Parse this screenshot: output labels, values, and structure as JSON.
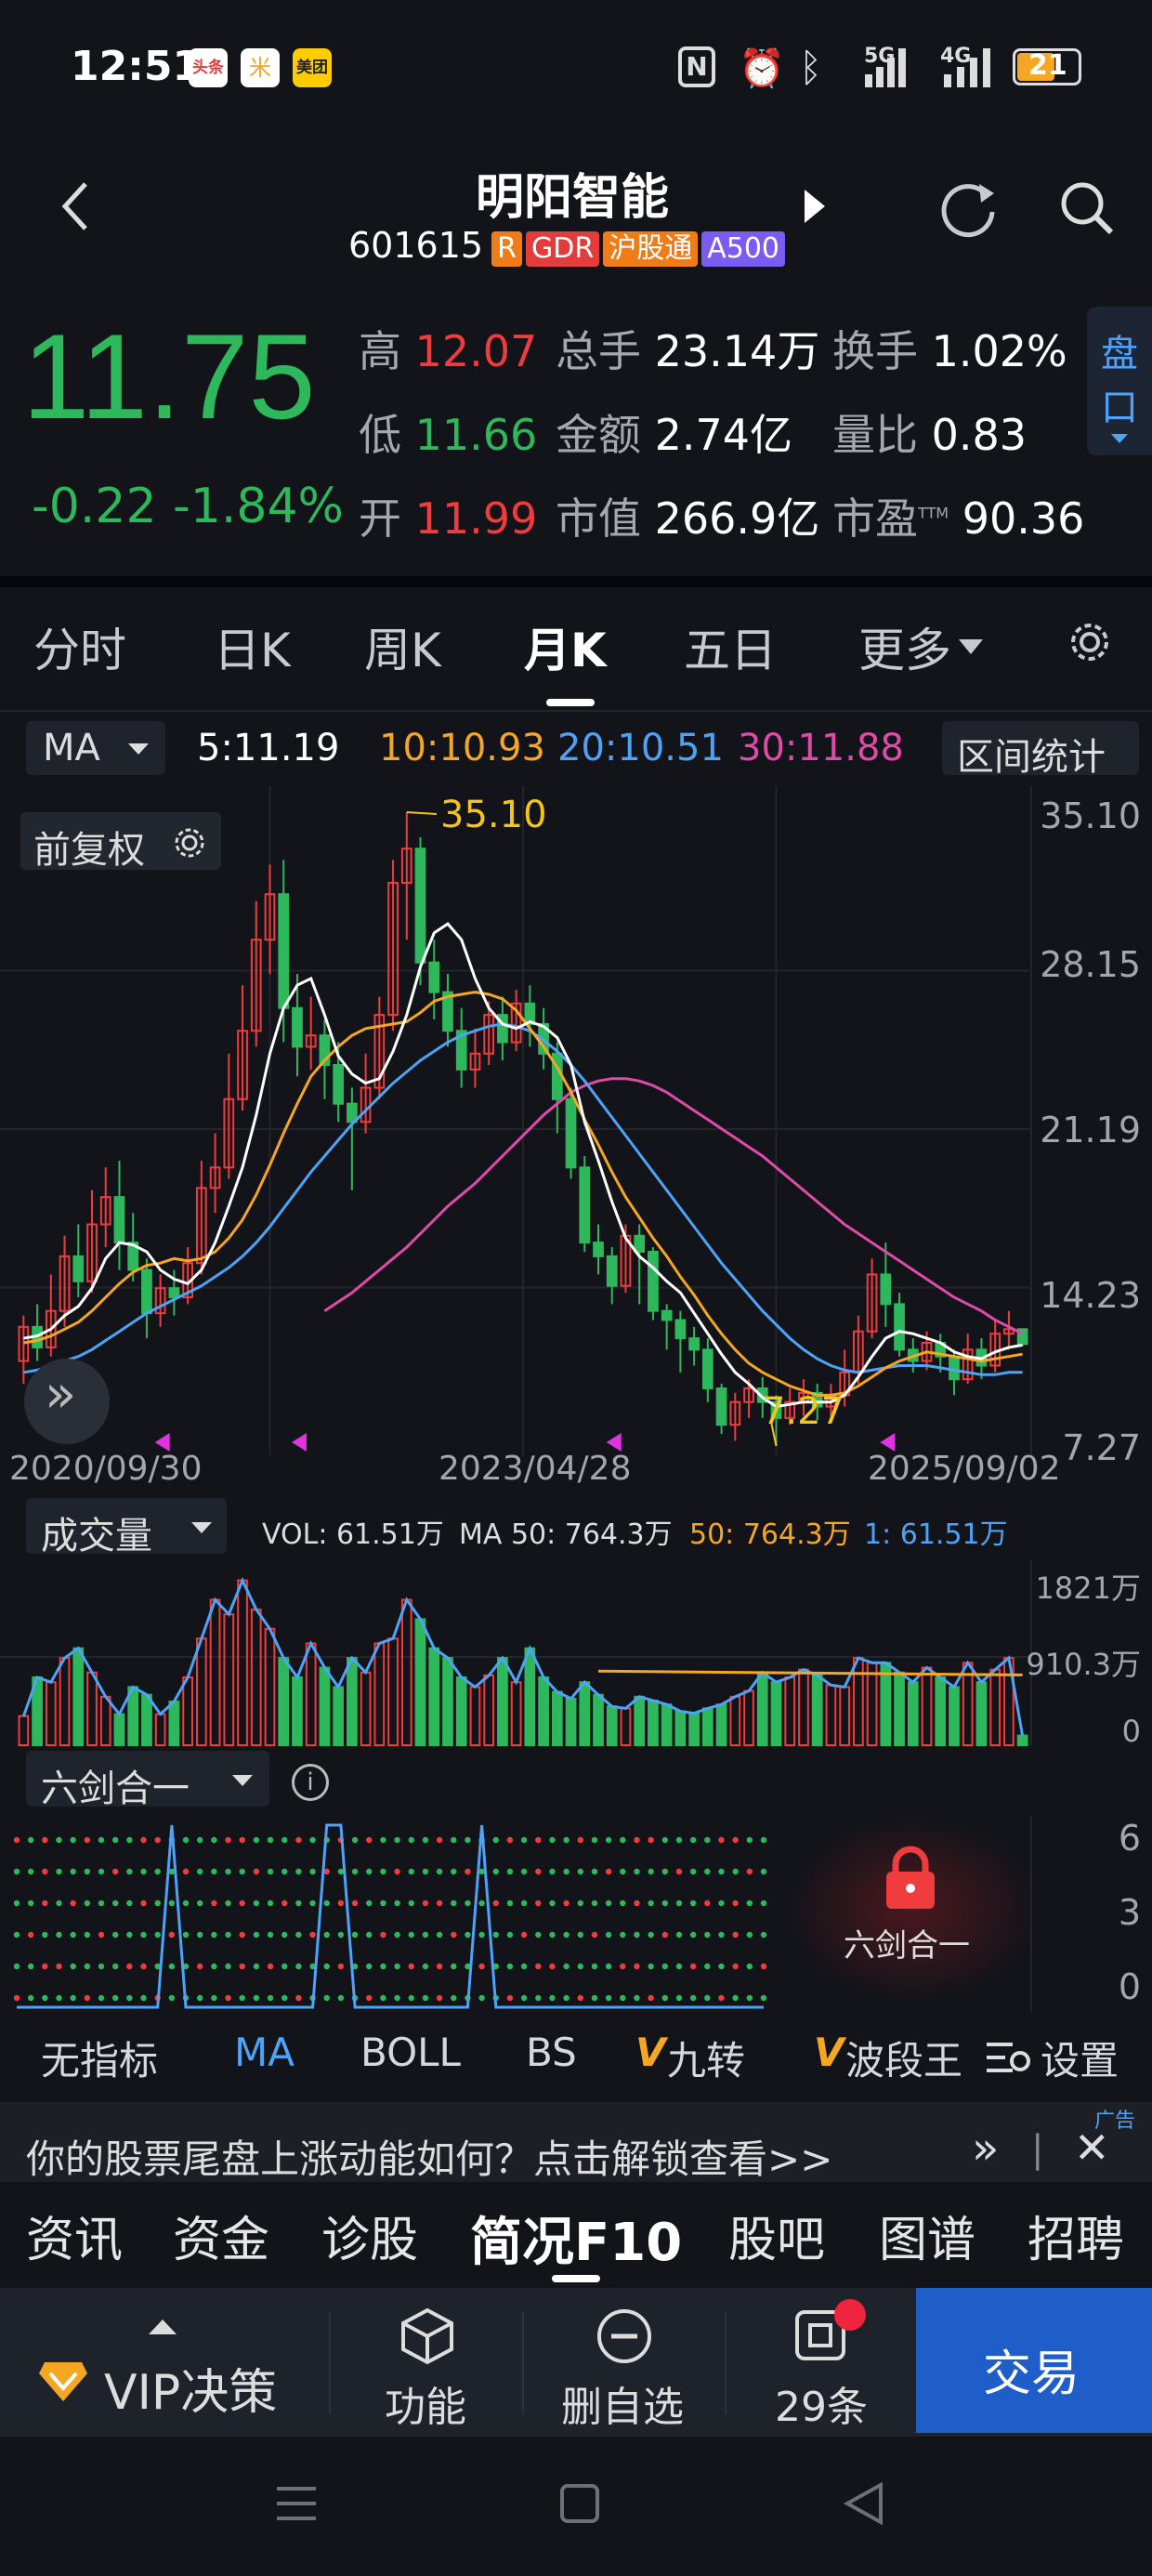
{
  "status_bar": {
    "time": "12:51",
    "app_badges": [
      "头条",
      "米",
      "美团"
    ],
    "network": "5G",
    "network2": "4G",
    "battery": "21"
  },
  "header": {
    "title": "明阳智能",
    "code": "601615",
    "tags": [
      {
        "label": "R",
        "color": "#f07c18"
      },
      {
        "label": "GDR",
        "color": "#e23c3c"
      },
      {
        "label": "沪股通",
        "color": "#f07c18"
      },
      {
        "label": "A500",
        "color": "#7a5cf0"
      }
    ]
  },
  "quote": {
    "price": "11.75",
    "change": "-0.22",
    "change_pct": "-1.84%",
    "rows": [
      [
        {
          "label": "高",
          "value": "12.07",
          "color": "up"
        },
        {
          "label": "总手",
          "value": "23.14万",
          "color": "white"
        },
        {
          "label": "换手",
          "value": "1.02%",
          "color": "white"
        }
      ],
      [
        {
          "label": "低",
          "value": "11.66",
          "color": "down"
        },
        {
          "label": "金额",
          "value": "2.74亿",
          "color": "white"
        },
        {
          "label": "量比",
          "value": "0.83",
          "color": "white"
        }
      ],
      [
        {
          "label": "开",
          "value": "11.99",
          "color": "up"
        },
        {
          "label": "市值",
          "value": "266.9亿",
          "color": "white"
        },
        {
          "label": "市盈",
          "value": "90.36",
          "color": "white"
        }
      ]
    ],
    "ttm": "TTM",
    "pankou": [
      "盘",
      "口"
    ]
  },
  "period_tabs": [
    "分时",
    "日K",
    "周K",
    "月K",
    "五日",
    "更多"
  ],
  "active_tab": "月K",
  "ma_bar": {
    "selector": "MA",
    "ma5": "5:11.19",
    "ma10": "10:10.93",
    "ma20": "20:10.51",
    "ma30": "30:11.88",
    "range_button": "区间统计"
  },
  "colors": {
    "ma5": "#ffffff",
    "ma10": "#f5a623",
    "ma20": "#4da3f7",
    "ma30": "#e04aa8",
    "up": "#f03c3c",
    "down": "#2eb85c",
    "accent": "#4da3f7"
  },
  "chart_data": {
    "type": "candlestick",
    "adjust_label": "前复权",
    "y_ticks": [
      "35.10",
      "28.15",
      "21.19",
      "14.23",
      "7.27"
    ],
    "ylim": [
      7.27,
      35.1
    ],
    "x_labels": [
      "2020/09/30",
      "2023/04/28",
      "2025/09/02"
    ],
    "high_annotation": "35.10",
    "low_annotation": "7.27",
    "candles": [
      [
        11.0,
        12.5,
        10.0,
        13.0
      ],
      [
        12.5,
        11.6,
        11.0,
        13.5
      ],
      [
        11.6,
        13.2,
        11.2,
        14.8
      ],
      [
        13.2,
        15.6,
        12.5,
        16.5
      ],
      [
        15.6,
        14.5,
        13.8,
        17.0
      ],
      [
        14.5,
        17.0,
        14.0,
        18.5
      ],
      [
        17.0,
        18.2,
        16.0,
        19.5
      ],
      [
        18.2,
        16.2,
        15.0,
        19.8
      ],
      [
        16.2,
        15.0,
        14.5,
        17.5
      ],
      [
        15.0,
        13.1,
        12.0,
        15.5
      ],
      [
        13.1,
        14.2,
        12.5,
        14.8
      ],
      [
        14.2,
        13.8,
        13.0,
        15.0
      ],
      [
        13.8,
        15.3,
        13.5,
        16.0
      ],
      [
        15.3,
        18.6,
        14.8,
        19.8
      ],
      [
        18.6,
        19.5,
        17.5,
        21.0
      ],
      [
        19.5,
        22.5,
        19.0,
        24.5
      ],
      [
        22.5,
        25.5,
        22.0,
        27.5
      ],
      [
        25.5,
        29.5,
        24.8,
        31.2
      ],
      [
        29.5,
        31.5,
        28.0,
        32.8
      ],
      [
        31.5,
        26.5,
        25.0,
        33.0
      ],
      [
        26.5,
        24.8,
        23.5,
        28.0
      ],
      [
        24.8,
        25.3,
        23.8,
        27.0
      ],
      [
        25.3,
        24.0,
        22.5,
        26.0
      ],
      [
        24.0,
        22.3,
        21.5,
        25.0
      ],
      [
        22.3,
        21.5,
        18.5,
        23.0
      ],
      [
        21.5,
        23.0,
        21.0,
        24.5
      ],
      [
        23.0,
        26.2,
        22.5,
        27.0
      ],
      [
        26.2,
        32.0,
        25.5,
        33.0
      ],
      [
        32.0,
        33.5,
        29.5,
        35.1
      ],
      [
        33.5,
        28.5,
        27.5,
        34.0
      ],
      [
        28.5,
        27.2,
        26.0,
        29.5
      ],
      [
        27.2,
        25.5,
        24.8,
        28.0
      ],
      [
        25.5,
        23.8,
        23.0,
        26.5
      ],
      [
        23.8,
        24.5,
        23.0,
        25.6
      ],
      [
        24.5,
        26.2,
        24.0,
        26.8
      ],
      [
        26.2,
        25.0,
        24.2,
        27.0
      ],
      [
        25.0,
        26.7,
        24.6,
        27.3
      ],
      [
        26.7,
        25.8,
        24.8,
        27.5
      ],
      [
        25.8,
        24.5,
        23.8,
        26.5
      ],
      [
        24.5,
        22.5,
        21.0,
        25.0
      ],
      [
        22.5,
        19.5,
        19.0,
        23.0
      ],
      [
        19.5,
        16.2,
        15.8,
        20.0
      ],
      [
        16.2,
        15.6,
        14.8,
        17.0
      ],
      [
        15.6,
        14.3,
        13.5,
        16.0
      ],
      [
        14.3,
        16.5,
        14.0,
        17.0
      ],
      [
        16.5,
        15.8,
        13.5,
        17.0
      ],
      [
        15.8,
        13.2,
        12.8,
        16.0
      ],
      [
        13.2,
        12.8,
        11.5,
        13.5
      ],
      [
        12.8,
        12.0,
        10.5,
        13.2
      ],
      [
        12.0,
        11.5,
        10.8,
        12.5
      ],
      [
        11.5,
        9.8,
        9.2,
        12.0
      ],
      [
        9.8,
        8.2,
        7.8,
        10.0
      ],
      [
        8.2,
        9.2,
        7.5,
        9.6
      ],
      [
        9.2,
        9.8,
        8.5,
        10.2
      ],
      [
        9.8,
        9.2,
        8.5,
        10.3
      ],
      [
        9.2,
        8.5,
        7.27,
        9.5
      ],
      [
        8.5,
        9.2,
        8.2,
        9.8
      ],
      [
        9.2,
        9.6,
        8.6,
        10.2
      ],
      [
        9.6,
        9.0,
        8.4,
        10.0
      ],
      [
        9.0,
        9.5,
        8.6,
        10.0
      ],
      [
        9.5,
        10.5,
        9.0,
        11.5
      ],
      [
        10.5,
        12.3,
        10.0,
        13.0
      ],
      [
        12.3,
        14.8,
        12.0,
        15.5
      ],
      [
        14.8,
        13.5,
        12.5,
        16.2
      ],
      [
        13.5,
        11.5,
        11.2,
        14.0
      ],
      [
        11.5,
        11.0,
        10.5,
        12.0
      ],
      [
        11.0,
        11.8,
        10.6,
        12.3
      ],
      [
        11.8,
        11.2,
        10.5,
        12.2
      ],
      [
        11.2,
        10.2,
        9.5,
        11.5
      ],
      [
        10.2,
        11.5,
        10.0,
        12.2
      ],
      [
        11.5,
        10.8,
        10.2,
        12.0
      ],
      [
        10.8,
        12.2,
        10.5,
        12.8
      ],
      [
        12.2,
        12.4,
        11.5,
        13.2
      ],
      [
        12.4,
        11.75,
        11.66,
        12.07
      ]
    ],
    "ma5": [
      12.0,
      12.1,
      12.4,
      13.0,
      13.4,
      14.2,
      15.5,
      16.2,
      16.1,
      15.8,
      15.0,
      14.6,
      14.4,
      15.0,
      16.2,
      17.8,
      19.5,
      21.8,
      24.5,
      26.5,
      27.5,
      27.8,
      26.2,
      24.4,
      23.6,
      23.2,
      23.4,
      24.6,
      26.2,
      28.3,
      29.8,
      30.2,
      29.5,
      27.8,
      26.5,
      25.8,
      25.6,
      25.9,
      25.7,
      25.2,
      24.0,
      21.5,
      19.8,
      18.0,
      16.4,
      15.6,
      15.1,
      14.5,
      14.0,
      13.1,
      12.2,
      11.3,
      10.5,
      10.0,
      9.4,
      9.0,
      9.1,
      9.2,
      9.2,
      9.2,
      9.5,
      10.3,
      11.2,
      12.0,
      12.3,
      12.2,
      12.0,
      11.8,
      11.4,
      11.2,
      11.1,
      11.4,
      11.6,
      11.7
    ],
    "ma10": [
      11.8,
      11.9,
      12.1,
      12.4,
      12.7,
      13.2,
      13.8,
      14.4,
      14.9,
      15.2,
      15.3,
      15.5,
      15.4,
      15.5,
      15.8,
      16.4,
      17.2,
      18.3,
      19.6,
      21.0,
      22.3,
      23.5,
      24.2,
      24.8,
      25.3,
      25.6,
      25.7,
      25.8,
      25.9,
      26.3,
      26.8,
      27.0,
      27.1,
      27.2,
      27.1,
      26.9,
      26.4,
      25.6,
      24.8,
      23.9,
      22.8,
      21.6,
      20.5,
      19.3,
      18.2,
      17.3,
      16.4,
      15.6,
      14.7,
      13.9,
      13.0,
      12.2,
      11.5,
      10.9,
      10.5,
      10.2,
      9.9,
      9.7,
      9.5,
      9.5,
      9.6,
      9.9,
      10.3,
      10.7,
      11.0,
      11.2,
      11.4,
      11.3,
      11.2,
      11.1,
      11.0,
      11.1,
      11.2,
      11.3
    ],
    "ma20": [
      10.5,
      10.6,
      10.8,
      11.0,
      11.2,
      11.5,
      11.9,
      12.3,
      12.7,
      13.1,
      13.4,
      13.7,
      14.0,
      14.3,
      14.7,
      15.1,
      15.6,
      16.2,
      16.9,
      17.7,
      18.5,
      19.3,
      20.0,
      20.7,
      21.4,
      22.0,
      22.6,
      23.2,
      23.7,
      24.2,
      24.6,
      25.0,
      25.3,
      25.5,
      25.7,
      25.8,
      25.7,
      25.5,
      25.1,
      24.6,
      24.0,
      23.3,
      22.5,
      21.7,
      20.9,
      20.1,
      19.3,
      18.5,
      17.7,
      16.9,
      16.1,
      15.3,
      14.6,
      13.9,
      13.2,
      12.6,
      12.0,
      11.5,
      11.1,
      10.8,
      10.6,
      10.5,
      10.6,
      10.7,
      10.8,
      10.8,
      10.8,
      10.7,
      10.6,
      10.5,
      10.4,
      10.4,
      10.5,
      10.5
    ],
    "ma30": [
      null,
      null,
      null,
      null,
      null,
      null,
      null,
      null,
      null,
      null,
      null,
      null,
      null,
      null,
      null,
      null,
      null,
      null,
      null,
      null,
      null,
      null,
      null,
      null,
      null,
      null,
      null,
      null,
      null,
      null,
      null,
      null,
      null,
      null,
      null,
      null,
      null,
      null,
      null,
      null,
      null,
      null,
      null,
      null,
      null,
      null,
      null,
      null,
      null,
      null,
      null,
      null,
      null,
      null,
      null,
      null,
      null,
      null,
      null,
      null,
      null,
      null,
      null,
      null,
      null,
      null,
      null,
      null,
      null,
      null,
      null,
      null,
      null,
      null
    ]
  },
  "ma30_values": [
    13.2,
    13.6,
    14.0,
    14.5,
    15.0,
    15.5,
    16.0,
    16.6,
    17.2,
    17.8,
    18.3,
    18.8,
    19.4,
    20.0,
    20.6,
    21.2,
    21.8,
    22.3,
    22.8,
    23.1,
    23.3,
    23.4,
    23.4,
    23.3,
    23.1,
    22.8,
    22.4,
    22.0,
    21.6,
    21.2,
    20.8,
    20.4,
    20.0,
    19.5,
    19.0,
    18.5,
    18.0,
    17.5,
    17.0,
    16.6,
    16.2,
    15.8,
    15.4,
    15.0,
    14.6,
    14.2,
    13.8,
    13.5,
    13.2,
    12.8,
    12.5,
    12.2
  ],
  "volume": {
    "selector": "成交量",
    "vol": "VOL: 61.51万",
    "ma50": "MA 50: 764.3万",
    "m50": "50: 764.3万",
    "m1": "1: 61.51万",
    "y_ticks": [
      "1821万",
      "910.3万",
      "0"
    ],
    "max": 1821,
    "values": [
      300,
      700,
      650,
      900,
      1000,
      750,
      500,
      320,
      600,
      520,
      320,
      450,
      700,
      1100,
      1500,
      1350,
      1700,
      1400,
      1200,
      900,
      700,
      1050,
      800,
      600,
      900,
      750,
      1050,
      1100,
      1500,
      1300,
      1000,
      900,
      700,
      600,
      720,
      900,
      650,
      1000,
      700,
      550,
      480,
      650,
      520,
      400,
      380,
      500,
      460,
      420,
      350,
      330,
      380,
      420,
      500,
      560,
      750,
      650,
      700,
      780,
      720,
      620,
      600,
      900,
      850,
      850,
      750,
      650,
      800,
      700,
      600,
      850,
      650,
      780,
      900,
      100
    ]
  },
  "six_sword": {
    "selector": "六剑合一",
    "info_icon": "i",
    "y_ticks": [
      "6",
      "3",
      "0"
    ],
    "lock_text": "六剑合一"
  },
  "indicator_bar": [
    "无指标",
    "MA",
    "BOLL",
    "BS",
    "九转",
    "波段王",
    "设置"
  ],
  "ad": {
    "badge": "广告",
    "text": "你的股票尾盘上涨动能如何？点击解锁查看>>"
  },
  "f10_tabs": [
    "资讯",
    "资金",
    "诊股",
    "简况F10",
    "股吧",
    "图谱",
    "招聘"
  ],
  "bottom_nav": {
    "vip": "VIP决策",
    "function": "功能",
    "remove": "删自选",
    "ask": "29条",
    "trade": "交易"
  }
}
